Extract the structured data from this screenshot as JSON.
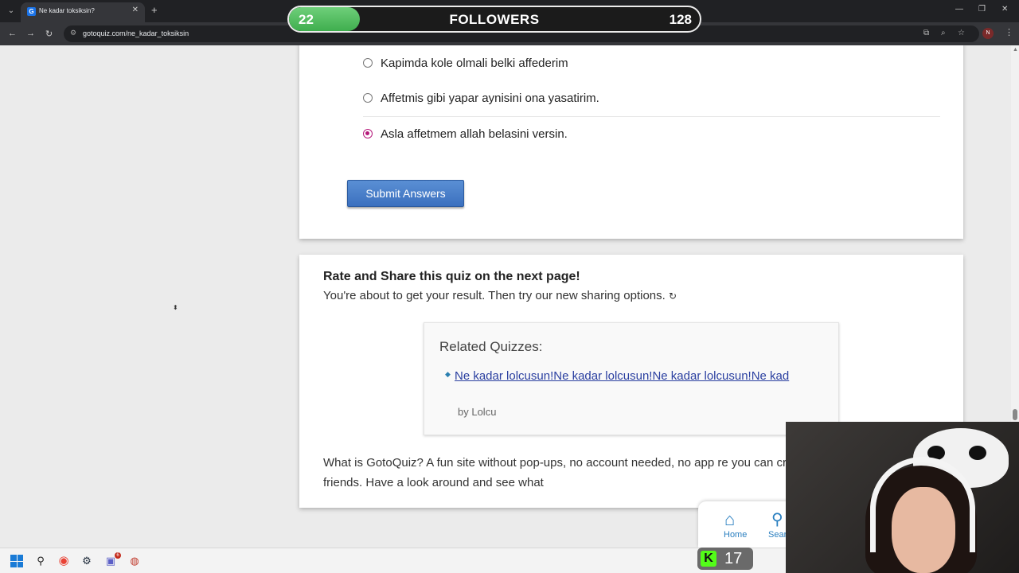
{
  "browser": {
    "tab_title": "Ne kadar toksiksin?",
    "tab_favicon": "G",
    "url": "gotoquiz.com/ne_kadar_toksiksin",
    "profile_initial": "N"
  },
  "followers_goal": {
    "current": "22",
    "label": "FOLLOWERS",
    "goal": "128",
    "progress_fraction": 0.172,
    "color": "#53c25f"
  },
  "quiz": {
    "options": [
      {
        "label": "Kapimda kole olmali belki affederim",
        "selected": false
      },
      {
        "label": "Affetmis gibi yapar aynisini ona yasatirim.",
        "selected": false
      },
      {
        "label": "Asla affetmem allah belasini versin.",
        "selected": true
      }
    ],
    "submit_label": "Submit Answers",
    "accent_color": "#b5197a"
  },
  "share": {
    "title": "Rate and Share this quiz on the next page!",
    "text": "You're about to get your result. Then try our new sharing options.",
    "emoji": "↻"
  },
  "related": {
    "title": "Related Quizzes:",
    "items": [
      {
        "title": "Ne kadar lolcusun!Ne kadar lolcusun!Ne kadar lolcusun!Ne kad",
        "author": "by Lolcu"
      }
    ]
  },
  "about": {
    "text": "What is GotoQuiz? A fun site without pop-ups, no account needed, no app re you can create and share with your friends. Have a look around and see what"
  },
  "bottom_nav": {
    "home_label": "Home",
    "search_label": "Sear"
  },
  "kick": {
    "count": "17",
    "logo": "K",
    "brand_color": "#53fc18"
  },
  "taskbar": {
    "teams_badge": "6"
  }
}
